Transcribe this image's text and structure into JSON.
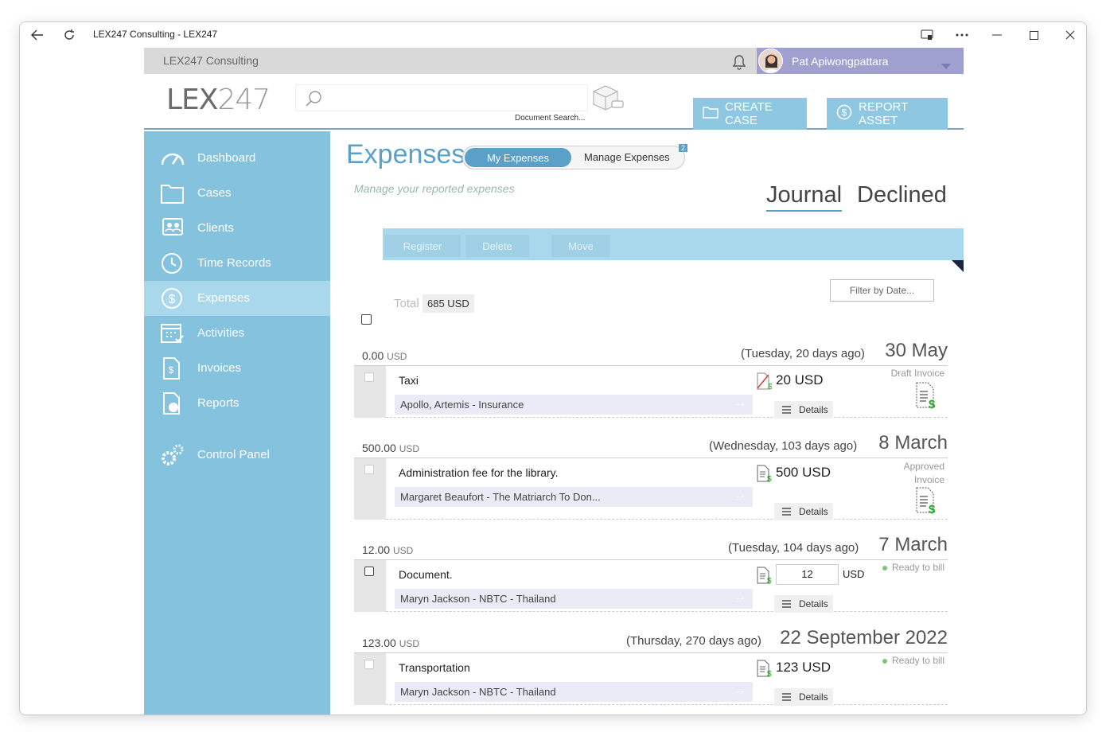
{
  "window": {
    "title": "LEX247 Consulting - LEX247"
  },
  "topbar": {
    "org": "LEX247 Consulting",
    "user_name": "Pat Apiwongpattara"
  },
  "header": {
    "logo_main": "LEX",
    "logo_thin": "247",
    "search_label": "Document Search...",
    "create_case": "CREATE CASE",
    "report_asset": "REPORT ASSET"
  },
  "sidebar": {
    "items": [
      {
        "label": "Dashboard",
        "icon": "dashboard-icon"
      },
      {
        "label": "Cases",
        "icon": "folder-icon"
      },
      {
        "label": "Clients",
        "icon": "clients-icon"
      },
      {
        "label": "Time Records",
        "icon": "clock-icon"
      },
      {
        "label": "Expenses",
        "icon": "dollar-circle-icon",
        "active": true
      },
      {
        "label": "Activities",
        "icon": "calendar-icon"
      },
      {
        "label": "Invoices",
        "icon": "invoice-icon"
      },
      {
        "label": "Reports",
        "icon": "report-icon"
      },
      {
        "label": "Control Panel",
        "icon": "gears-icon"
      }
    ]
  },
  "main": {
    "title": "Expenses",
    "seg_my": "My Expenses",
    "seg_manage": "Manage Expenses",
    "seg_badge": "2",
    "subtitle": "Manage your reported expenses",
    "tab_journal": "Journal",
    "tab_declined": "Declined",
    "actions": {
      "register": "Register",
      "delete": "Delete",
      "move": "Move"
    },
    "filter": "Filter by Date...",
    "total_label": "Total",
    "total_value": "685 USD"
  },
  "groups": [
    {
      "amount": "0.00",
      "currency": "USD",
      "relative": "(Tuesday, 20 days ago)",
      "date": "30 May",
      "description": "Taxi",
      "client": "Apollo, Artemis - Insurance",
      "expense_amount": "20 USD",
      "details": "Details",
      "status": "Draft Invoice"
    },
    {
      "amount": "500.00",
      "currency": "USD",
      "relative": "(Wednesday, 103 days ago)",
      "date": "8 March",
      "description": "Administration fee for the library.",
      "client": "Margaret Beaufort - The Matriarch To Don...",
      "expense_amount": "500 USD",
      "details": "Details",
      "status_line1": "Approved",
      "status_line2": "Invoice"
    },
    {
      "amount": "12.00",
      "currency": "USD",
      "relative": "(Tuesday, 104 days ago)",
      "date": "7 March",
      "description": "Document.",
      "client": "Maryn Jackson - NBTC - Thailand",
      "input_value": "12",
      "input_unit": "USD",
      "details": "Details",
      "status": "Ready to bill"
    },
    {
      "amount": "123.00",
      "currency": "USD",
      "relative": "(Thursday, 270 days ago)",
      "date": "22 September 2022",
      "description": "Transportation",
      "client": "Maryn Jackson - NBTC - Thailand",
      "expense_amount": "123 USD",
      "details": "Details",
      "status": "Ready to bill"
    }
  ]
}
